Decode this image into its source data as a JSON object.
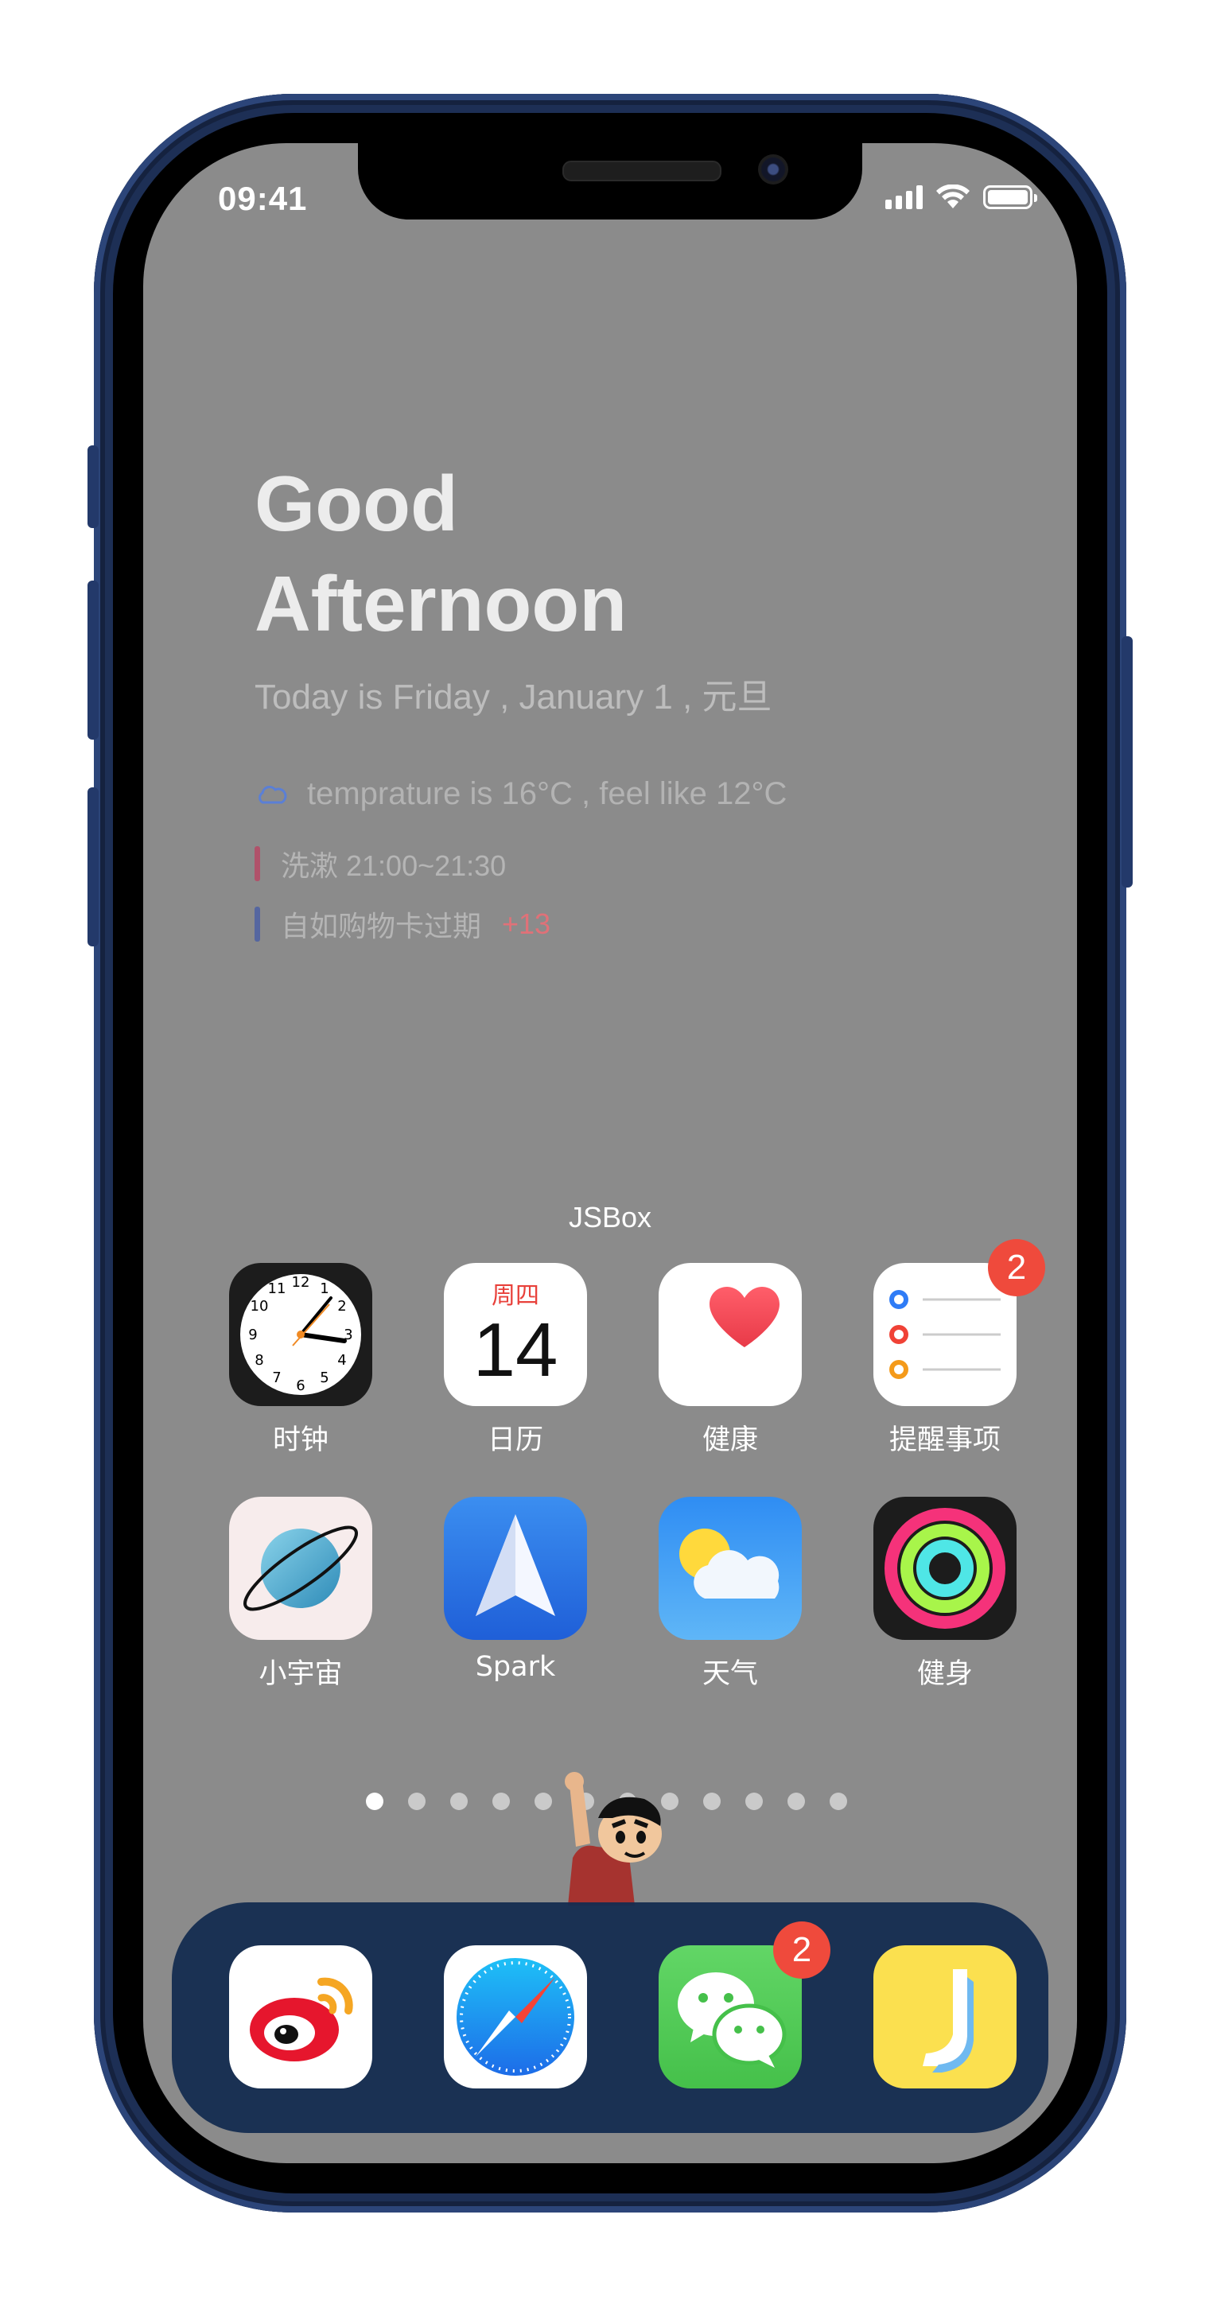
{
  "status_bar": {
    "time": "09:41",
    "signal_icon": "cellular-signal-icon",
    "wifi_icon": "wifi-icon",
    "battery_icon": "battery-icon",
    "battery_level": 1.0
  },
  "widget": {
    "greeting_line1": "Good",
    "greeting_line2": "Afternoon",
    "date_text": "Today is Friday , January 1 , 元旦",
    "weather_icon": "cloud-icon",
    "weather_text": "temprature is 16°C , feel like 12°C",
    "events": [
      {
        "text": "洗漱 21:00~21:30",
        "extra": "",
        "color": "#b0526a"
      },
      {
        "text": "自如购物卡过期",
        "extra": "+13",
        "color": "#5566a0"
      }
    ],
    "app_label": "JSBox"
  },
  "apps": [
    {
      "label": "时钟",
      "icon": "clock-icon",
      "badge": ""
    },
    {
      "label": "日历",
      "icon": "calendar-icon",
      "badge": "",
      "weekday": "周四",
      "day": "14"
    },
    {
      "label": "健康",
      "icon": "health-heart-icon",
      "badge": ""
    },
    {
      "label": "提醒事项",
      "icon": "reminders-icon",
      "badge": "2"
    },
    {
      "label": "小宇宙",
      "icon": "planet-icon",
      "badge": ""
    },
    {
      "label": "Spark",
      "icon": "paper-plane-icon",
      "badge": ""
    },
    {
      "label": "天气",
      "icon": "weather-icon",
      "badge": ""
    },
    {
      "label": "健身",
      "icon": "activity-rings-icon",
      "badge": ""
    }
  ],
  "page_dots": {
    "count": 12,
    "active_index": 0
  },
  "dock": [
    {
      "name": "weibo",
      "icon": "weibo-icon",
      "badge": ""
    },
    {
      "name": "safari",
      "icon": "safari-compass-icon",
      "badge": ""
    },
    {
      "name": "wechat",
      "icon": "wechat-icon",
      "badge": "2"
    },
    {
      "name": "jike",
      "icon": "jike-icon",
      "badge": ""
    }
  ],
  "colors": {
    "screen_bg": "#8b8b8b",
    "dock_bg": "#142c50",
    "badge": "#ef4a3c",
    "frame": "#1d2f55"
  }
}
